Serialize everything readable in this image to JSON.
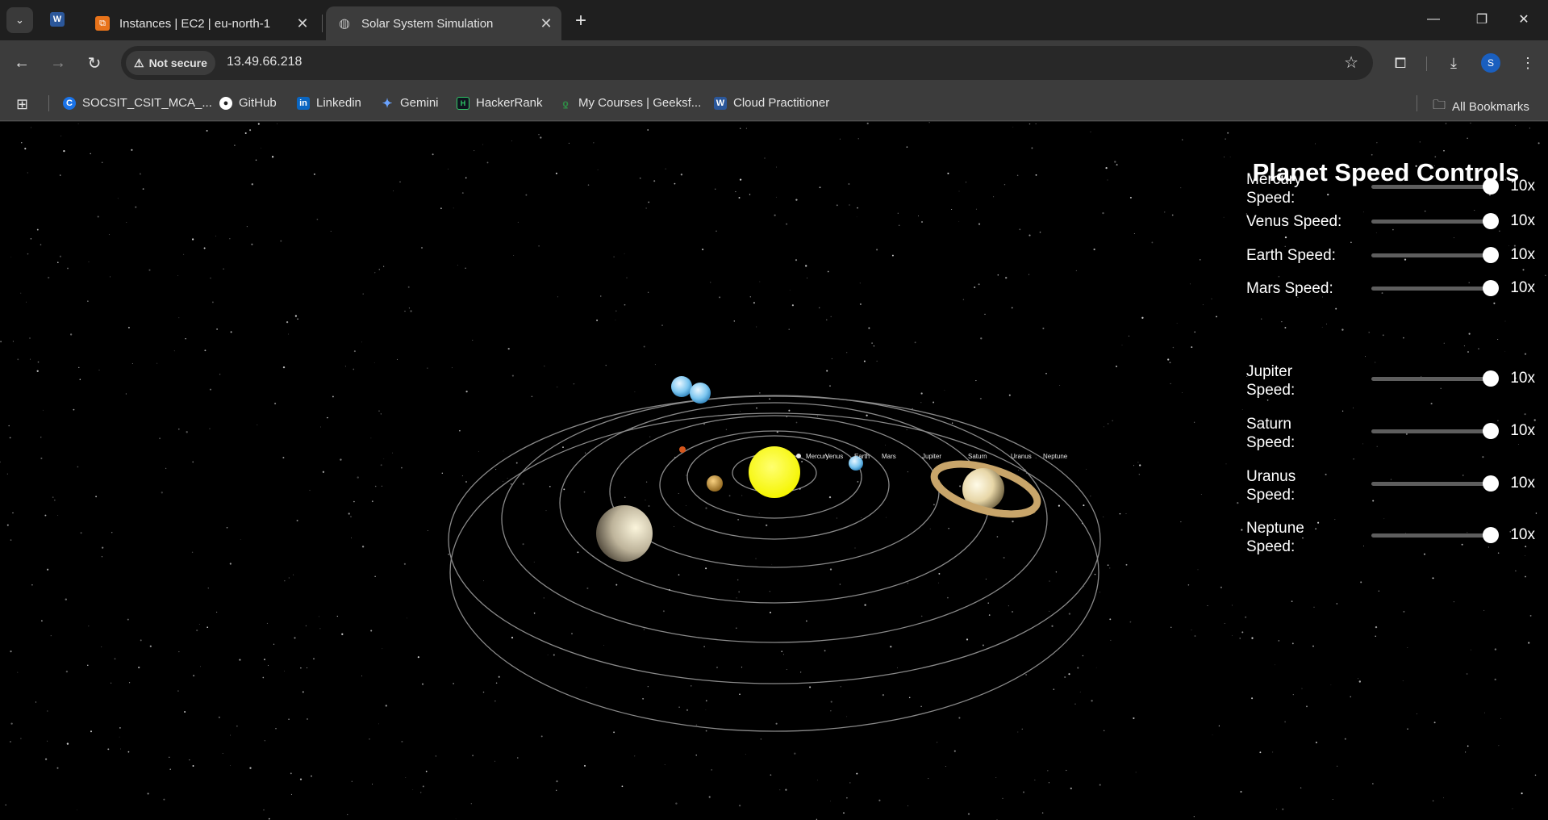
{
  "browser": {
    "tabs": [
      {
        "title": "Instances | EC2 | eu-north-1",
        "active": false,
        "icon": "aws-icon"
      },
      {
        "title": "Solar System Simulation",
        "active": true,
        "icon": "globe-icon"
      }
    ],
    "pinned_tab_icon": "word-icon",
    "security_chip": "Not secure",
    "url": "13.49.66.218",
    "profile_initial": "S",
    "bookmarks": [
      {
        "label": "SOCSIT_CSIT_MCA_...",
        "icon": "c-icon"
      },
      {
        "label": "GitHub",
        "icon": "github-icon"
      },
      {
        "label": "Linkedin",
        "icon": "linkedin-icon"
      },
      {
        "label": "Gemini",
        "icon": "gemini-icon"
      },
      {
        "label": "HackerRank",
        "icon": "hackerrank-icon"
      },
      {
        "label": "My Courses | Geeksf...",
        "icon": "gfg-icon"
      },
      {
        "label": "Cloud Practitioner",
        "icon": "word-icon"
      }
    ],
    "all_bookmarks": "All Bookmarks"
  },
  "simulation": {
    "planet_labels": [
      "Mercury",
      "Venus",
      "Earth",
      "Mars",
      "Jupiter",
      "Saturn",
      "Uranus",
      "Neptune"
    ],
    "colors": {
      "sun": "#ffff00",
      "orbit": "#8a8a8a",
      "background": "#000000"
    }
  },
  "controls": {
    "title": "Planet Speed Controls",
    "sliders": [
      {
        "label": "Mercury Speed:",
        "value": 10,
        "value_label": "10x",
        "max": 10
      },
      {
        "label": "Venus Speed:",
        "value": 10,
        "value_label": "10x",
        "max": 10
      },
      {
        "label": "Earth Speed:",
        "value": 10,
        "value_label": "10x",
        "max": 10
      },
      {
        "label": "Mars Speed:",
        "value": 10,
        "value_label": "10x",
        "max": 10
      },
      {
        "label": "Jupiter Speed:",
        "value": 10,
        "value_label": "10x",
        "max": 10
      },
      {
        "label": "Saturn Speed:",
        "value": 10,
        "value_label": "10x",
        "max": 10
      },
      {
        "label": "Uranus Speed:",
        "value": 10,
        "value_label": "10x",
        "max": 10
      },
      {
        "label": "Neptune Speed:",
        "value": 10,
        "value_label": "10x",
        "max": 10
      }
    ]
  }
}
